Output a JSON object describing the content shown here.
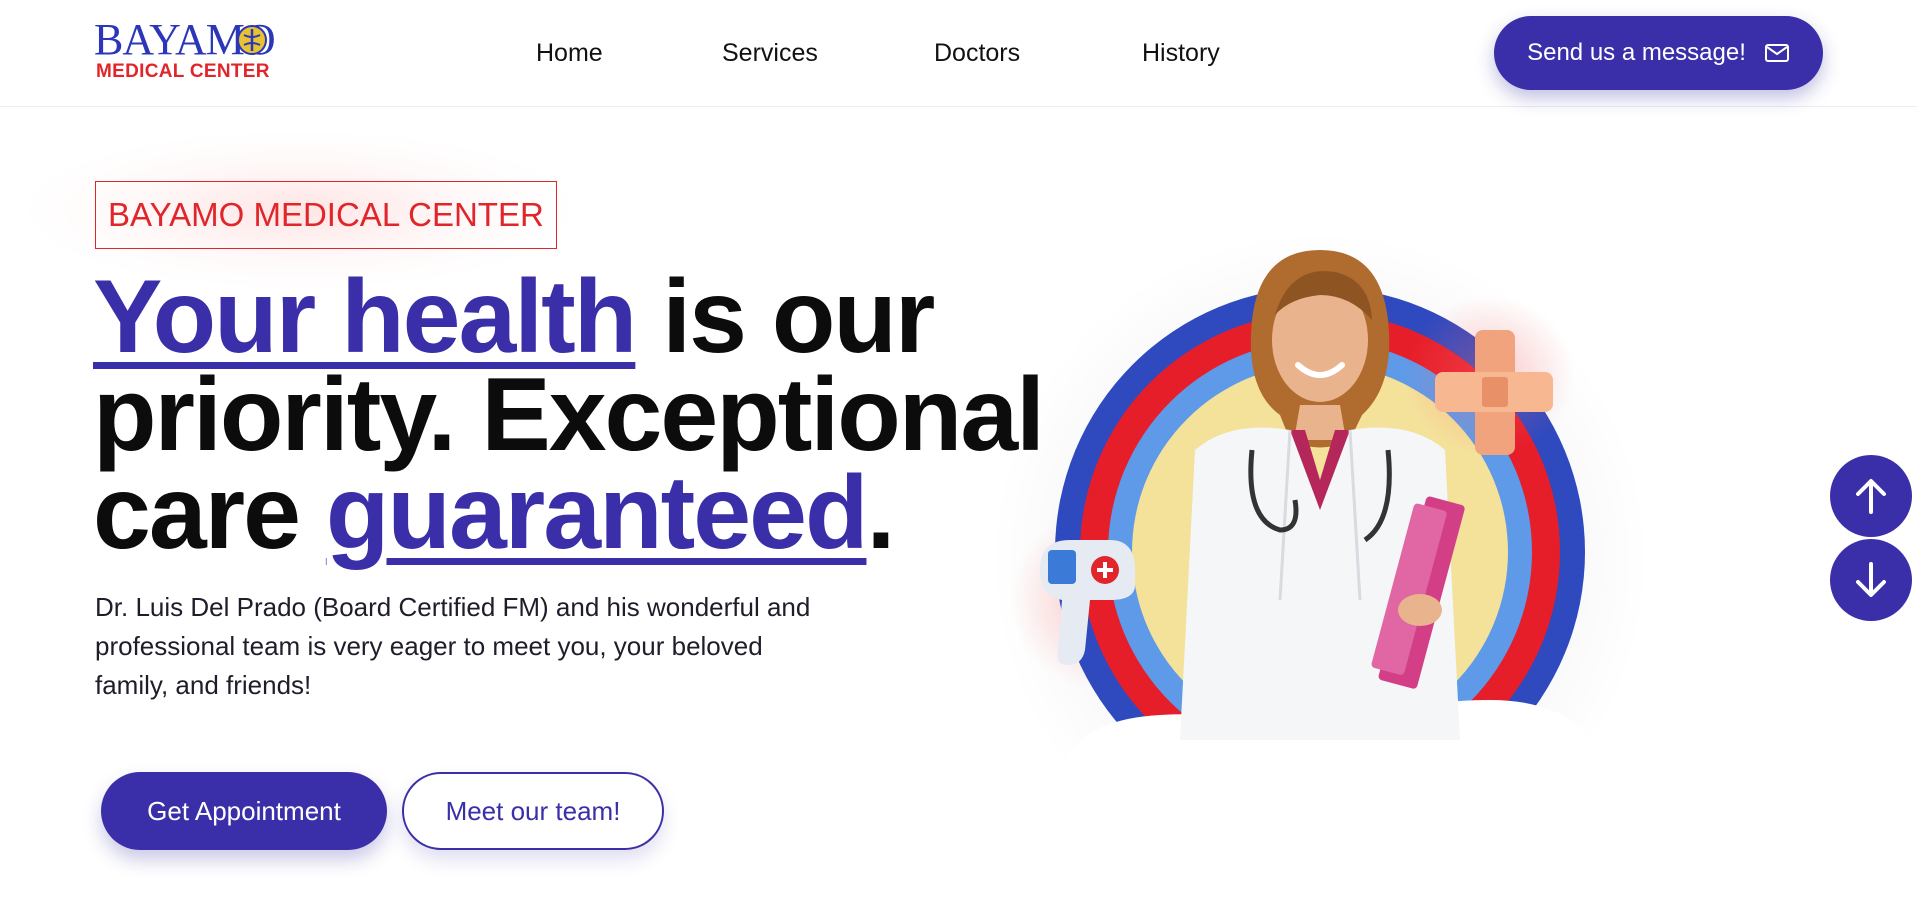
{
  "brand": {
    "logo_top": "BAYAMO",
    "logo_bottom": "MEDICAL CENTER",
    "logo_mark_icon": "medical-caduceus-icon"
  },
  "nav": {
    "items": [
      {
        "label": "Home"
      },
      {
        "label": "Services"
      },
      {
        "label": "Doctors"
      },
      {
        "label": "History"
      }
    ]
  },
  "header_cta": {
    "label": "Send us a message!",
    "icon": "envelope-icon"
  },
  "hero": {
    "badge": "BAYAMO MEDICAL CENTER",
    "headline": {
      "part1_highlight": "Your health",
      "part1_rest": " is our",
      "line2": "priority. Exceptional",
      "line3_start": "care ",
      "line3_highlight": "guaranteed",
      "line3_end": "."
    },
    "description": "Dr. Luis Del Prado (Board Certified FM) and his wonderful and professional team is very eager to meet you, your beloved family, and friends!",
    "primary_button": "Get Appointment",
    "secondary_button": "Meet our team!",
    "illustration_icons": [
      "doctor-portrait-icon",
      "thermometer-gun-icon",
      "bandage-cross-icon"
    ]
  },
  "scroll_controls": {
    "up_icon": "arrow-up-icon",
    "down_icon": "arrow-down-icon"
  },
  "colors": {
    "primary": "#3a2fa8",
    "accent_red": "#e0262b",
    "ring_blue": "#2f49bf",
    "ring_red": "#e61e2a",
    "ring_light_blue": "#5f9ae8",
    "ring_yellow": "#f4e19a"
  }
}
